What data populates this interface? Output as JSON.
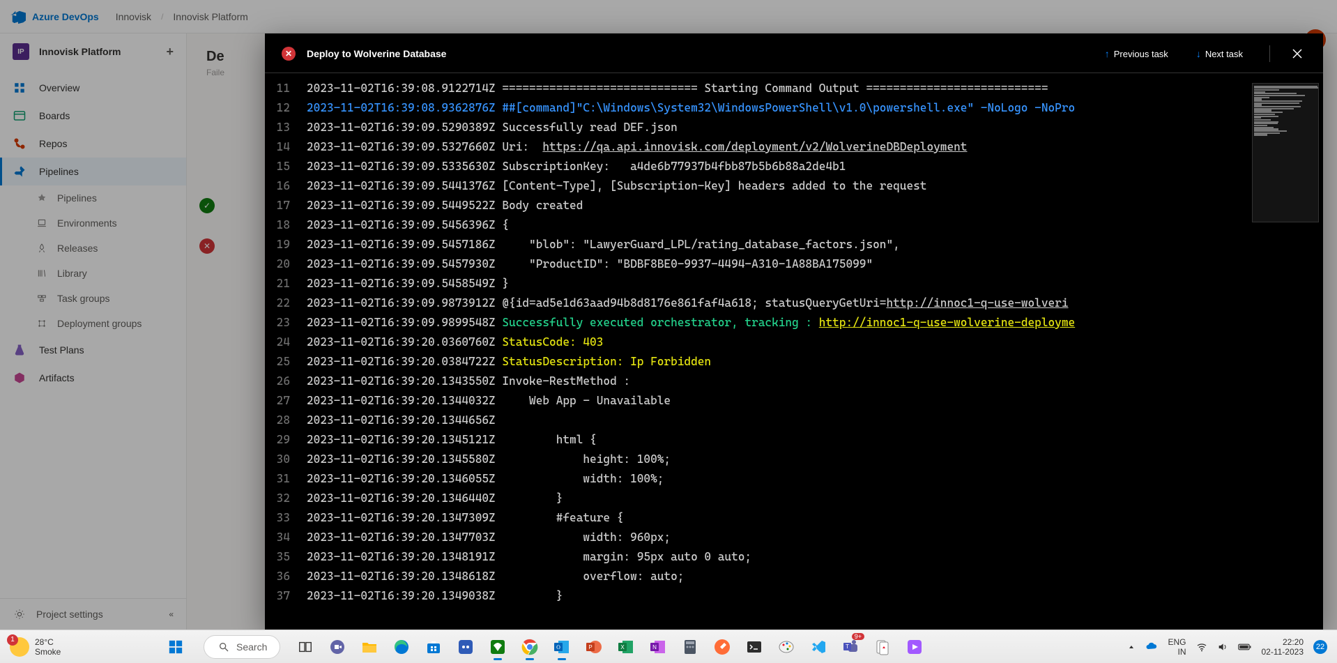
{
  "header": {
    "brand": "Azure DevOps",
    "org": "Innovisk",
    "project": "Innovisk Platform"
  },
  "sidebar": {
    "project_initials": "IP",
    "project_name": "Innovisk Platform",
    "overview": "Overview",
    "boards": "Boards",
    "repos": "Repos",
    "pipelines": "Pipelines",
    "sub_pipelines": "Pipelines",
    "sub_environments": "Environments",
    "sub_releases": "Releases",
    "sub_library": "Library",
    "sub_taskgroups": "Task groups",
    "sub_deployment": "Deployment groups",
    "testplans": "Test Plans",
    "artifacts": "Artifacts",
    "project_settings": "Project settings"
  },
  "bg": {
    "title_start": "De",
    "sub_start": "Faile"
  },
  "panel": {
    "title": "Deploy to Wolverine Database",
    "prev": "Previous task",
    "next": "Next task"
  },
  "log": [
    {
      "n": "11",
      "ts": "2023-11-02T16:39:08.9122714Z",
      "body": "============================= Starting Command Output ===========================",
      "cls": "ln-text"
    },
    {
      "n": "12",
      "ts": "2023-11-02T16:39:08.9362876Z",
      "body": "##[command]\"C:\\Windows\\System32\\WindowsPowerShell\\v1.0\\powershell.exe\" -NoLogo -NoPro",
      "cls": "ln-blue",
      "tscls": "ln-blue"
    },
    {
      "n": "13",
      "ts": "2023-11-02T16:39:09.5290389Z",
      "body": "Successfully read DEF.json",
      "cls": "ln-text"
    },
    {
      "n": "14",
      "ts": "2023-11-02T16:39:09.5327660Z",
      "body": "Uri:  ",
      "cls": "ln-text",
      "link": "https://qa.api.innovisk.com/deployment/v2/WolverineDBDeployment",
      "linkcls": "ln-link-w"
    },
    {
      "n": "15",
      "ts": "2023-11-02T16:39:09.5335630Z",
      "body": "SubscriptionKey:   a4de6b77937b4fbb87b5b6b88a2de4b1",
      "cls": "ln-text"
    },
    {
      "n": "16",
      "ts": "2023-11-02T16:39:09.5441376Z",
      "body": "[Content-Type], [Subscription-Key] headers added to the request",
      "cls": "ln-text"
    },
    {
      "n": "17",
      "ts": "2023-11-02T16:39:09.5449522Z",
      "body": "Body created",
      "cls": "ln-text"
    },
    {
      "n": "18",
      "ts": "2023-11-02T16:39:09.5456396Z",
      "body": "{",
      "cls": "ln-text"
    },
    {
      "n": "19",
      "ts": "2023-11-02T16:39:09.5457186Z",
      "body": "    \"blob\": \"LawyerGuard_LPL/rating_database_factors.json\",",
      "cls": "ln-text"
    },
    {
      "n": "20",
      "ts": "2023-11-02T16:39:09.5457930Z",
      "body": "    \"ProductID\": \"BDBF8BE0-9937-4494-A310-1A88BA175099\"",
      "cls": "ln-text"
    },
    {
      "n": "21",
      "ts": "2023-11-02T16:39:09.5458549Z",
      "body": "}",
      "cls": "ln-text"
    },
    {
      "n": "22",
      "ts": "2023-11-02T16:39:09.9873912Z",
      "body": "@{id=ad5e1d63aad94b8d8176e861faf4a618; statusQueryGetUri=",
      "cls": "ln-text",
      "link": "http://innoc1-q-use-wolveri",
      "linkcls": "ln-link-w"
    },
    {
      "n": "23",
      "ts": "2023-11-02T16:39:09.9899548Z",
      "body": "Successfully executed orchestrator, tracking : ",
      "cls": "ln-green",
      "link": "http://innoc1-q-use-wolverine-deployme",
      "linkcls": "ln-link"
    },
    {
      "n": "24",
      "ts": "2023-11-02T16:39:20.0360760Z",
      "body": "StatusCode: 403",
      "cls": "ln-yellow"
    },
    {
      "n": "25",
      "ts": "2023-11-02T16:39:20.0384722Z",
      "body": "StatusDescription: Ip Forbidden",
      "cls": "ln-yellow"
    },
    {
      "n": "26",
      "ts": "2023-11-02T16:39:20.1343550Z",
      "body": "Invoke-RestMethod : ",
      "cls": "ln-text"
    },
    {
      "n": "27",
      "ts": "2023-11-02T16:39:20.1344032Z",
      "body": "    Web App - Unavailable",
      "cls": "ln-text"
    },
    {
      "n": "28",
      "ts": "2023-11-02T16:39:20.1344656Z",
      "body": "",
      "cls": "ln-text"
    },
    {
      "n": "29",
      "ts": "2023-11-02T16:39:20.1345121Z",
      "body": "        html {",
      "cls": "ln-text"
    },
    {
      "n": "30",
      "ts": "2023-11-02T16:39:20.1345580Z",
      "body": "            height: 100%;",
      "cls": "ln-text"
    },
    {
      "n": "31",
      "ts": "2023-11-02T16:39:20.1346055Z",
      "body": "            width: 100%;",
      "cls": "ln-text"
    },
    {
      "n": "32",
      "ts": "2023-11-02T16:39:20.1346440Z",
      "body": "        }",
      "cls": "ln-text"
    },
    {
      "n": "33",
      "ts": "2023-11-02T16:39:20.1347309Z",
      "body": "        #feature {",
      "cls": "ln-text"
    },
    {
      "n": "34",
      "ts": "2023-11-02T16:39:20.1347703Z",
      "body": "            width: 960px;",
      "cls": "ln-text"
    },
    {
      "n": "35",
      "ts": "2023-11-02T16:39:20.1348191Z",
      "body": "            margin: 95px auto 0 auto;",
      "cls": "ln-text"
    },
    {
      "n": "36",
      "ts": "2023-11-02T16:39:20.1348618Z",
      "body": "            overflow: auto;",
      "cls": "ln-text"
    },
    {
      "n": "37",
      "ts": "2023-11-02T16:39:20.1349038Z",
      "body": "        }",
      "cls": "ln-text"
    }
  ],
  "taskbar": {
    "temp": "28°C",
    "cond": "Smoke",
    "weather_badge": "1",
    "search": "Search",
    "lang1": "ENG",
    "lang2": "IN",
    "time": "22:20",
    "date": "02-11-2023",
    "notif": "22"
  }
}
